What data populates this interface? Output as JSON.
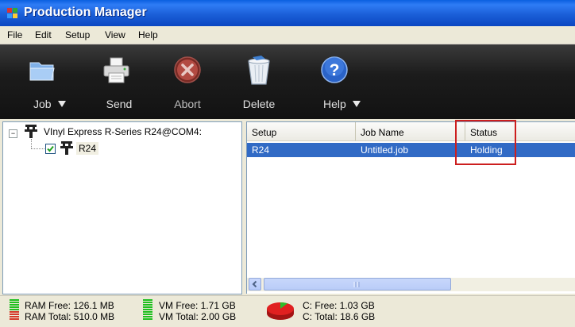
{
  "window": {
    "title": "Production Manager"
  },
  "menu": {
    "items": [
      "File",
      "Edit",
      "Setup",
      "View",
      "Help"
    ]
  },
  "toolbar": {
    "buttons": [
      {
        "label": "Job",
        "icon": "folder-icon",
        "dropdown": true
      },
      {
        "label": "Send",
        "icon": "printer-icon",
        "dropdown": false
      },
      {
        "label": "Abort",
        "icon": "abort-icon",
        "dropdown": false
      },
      {
        "label": "Delete",
        "icon": "trash-icon",
        "dropdown": false
      },
      {
        "label": "Help",
        "icon": "help-icon",
        "dropdown": true
      }
    ]
  },
  "tree": {
    "root_label": "VInyl Express R-Series R24@COM4:",
    "root_expander": "−",
    "child_label": "R24",
    "child_checked": true
  },
  "list": {
    "columns": [
      "Setup",
      "Job Name",
      "Status"
    ],
    "rows": [
      {
        "setup": "R24",
        "job_name": "Untitled.job",
        "status": "Holding"
      }
    ]
  },
  "status": {
    "ram_free": "RAM Free: 126.1 MB",
    "ram_total": "RAM Total: 510.0 MB",
    "vm_free": "VM Free: 1.71 GB",
    "vm_total": "VM Total: 2.00 GB",
    "c_free": "C: Free: 1.03 GB",
    "c_total": "C: Total: 18.6 GB"
  },
  "colors": {
    "selection": "#316ac5",
    "highlight_box": "#cc1e1e",
    "title_bar": "#0b47c2"
  }
}
